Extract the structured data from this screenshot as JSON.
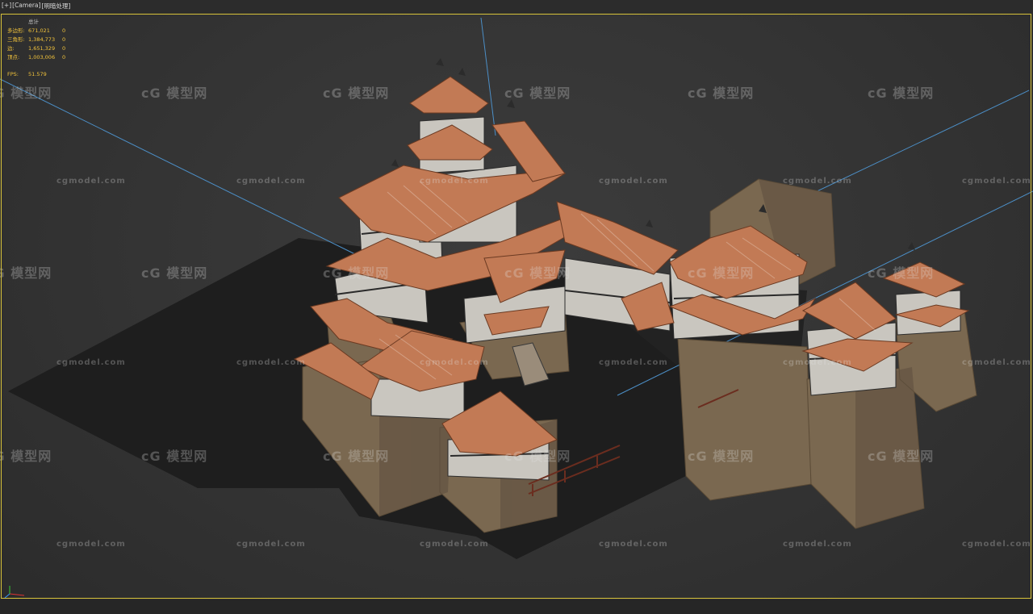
{
  "viewport": {
    "labels": [
      "[+]",
      "[Camera]",
      "[明暗处理]"
    ],
    "border_color": "#d7c23a"
  },
  "stats": {
    "header": "总计",
    "rows": [
      {
        "label": "多边形:",
        "value": "671,021",
        "extra": "0"
      },
      {
        "label": "三角形:",
        "value": "1,384,773",
        "extra": "0"
      },
      {
        "label": "边:",
        "value": "1,651,329",
        "extra": "0"
      },
      {
        "label": "顶点:",
        "value": "1,003,006",
        "extra": "0"
      }
    ],
    "fps_label": "FPS:",
    "fps_value": "51.579"
  },
  "watermark": {
    "logo_text": "模型网",
    "logo_glyph": "cG",
    "url_text": "cgmodel.com"
  },
  "scene": {
    "subject": "3D castle model",
    "roof_color": "#c27a55",
    "stone_color": "#7a6850",
    "wall_color": "#c9c6bf",
    "shadow_color": "#1f1f1f",
    "camera_line_color": "#4c8fc7"
  }
}
